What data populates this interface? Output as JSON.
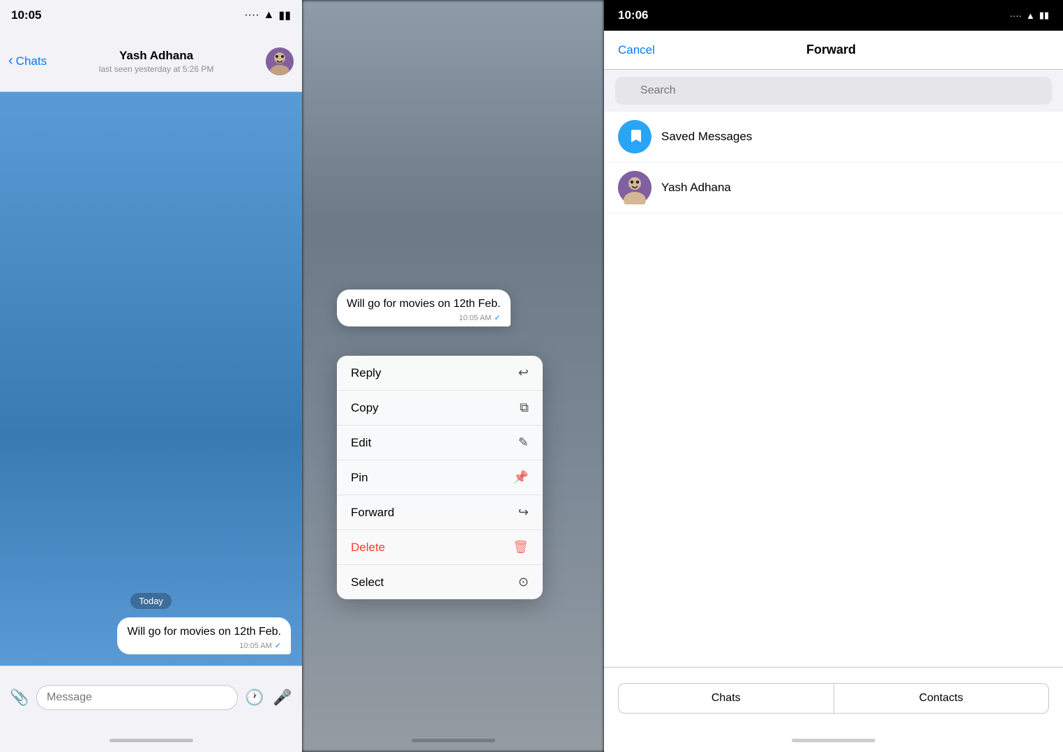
{
  "panel1": {
    "status_time": "10:05",
    "contact_name": "Yash Adhana",
    "contact_status": "last seen yesterday at 5:26 PM",
    "back_label": "Chats",
    "date_badge": "Today",
    "message_text": "Will go for movies on 12th Feb.",
    "message_time": "10:05 AM",
    "input_placeholder": "Message"
  },
  "panel2": {
    "message_text": "Will go for movies on 12th Feb.",
    "message_time": "10:05 AM",
    "menu_items": [
      {
        "label": "Reply",
        "icon": "↩",
        "style": "normal"
      },
      {
        "label": "Copy",
        "icon": "⧉",
        "style": "normal"
      },
      {
        "label": "Edit",
        "icon": "✎",
        "style": "normal"
      },
      {
        "label": "Pin",
        "icon": "📌",
        "style": "normal"
      },
      {
        "label": "Forward",
        "icon": "↪",
        "style": "normal"
      },
      {
        "label": "Delete",
        "icon": "🗑",
        "style": "delete"
      },
      {
        "label": "Select",
        "icon": "✓",
        "style": "normal"
      }
    ]
  },
  "panel3": {
    "status_time": "10:06",
    "cancel_label": "Cancel",
    "title": "Forward",
    "search_placeholder": "Search",
    "contacts": [
      {
        "name": "Saved Messages",
        "type": "saved"
      },
      {
        "name": "Yash Adhana",
        "type": "yash"
      }
    ],
    "tab_chats": "Chats",
    "tab_contacts": "Contacts"
  }
}
